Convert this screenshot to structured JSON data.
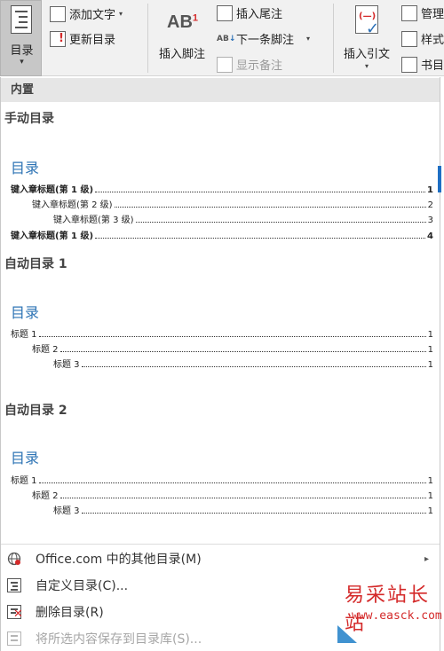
{
  "ribbon": {
    "toc_button": {
      "label": "目录",
      "arrow": "▾"
    },
    "add_text": {
      "label": "添加文字",
      "arrow": "▾"
    },
    "update_toc": {
      "label": "更新目录"
    },
    "insert_footnote": {
      "icon_text": "AB",
      "icon_sup": "1",
      "label": "插入脚注"
    },
    "insert_endnote": {
      "label": "插入尾注"
    },
    "next_footnote": {
      "label": "下一条脚注",
      "arrow": "▾"
    },
    "show_notes": {
      "label": "显示备注"
    },
    "insert_citation": {
      "label": "插入引文",
      "arrow": "▾",
      "icon_text": "(—)"
    },
    "manage": {
      "label": "管理"
    },
    "style": {
      "label": "样式"
    },
    "bibliography": {
      "label": "书目"
    }
  },
  "panel": {
    "section_header": "内置",
    "galleries": [
      {
        "title": "手动目录",
        "heading": "目录",
        "lines": [
          {
            "text": "键入章标题(第 1 级)",
            "page": "1",
            "level": 1,
            "bold": true
          },
          {
            "text": "键入章标题(第 2 级)",
            "page": "2",
            "level": 2,
            "bold": false
          },
          {
            "text": "键入章标题(第 3 级)",
            "page": "3",
            "level": 3,
            "bold": false
          },
          {
            "text": "键入章标题(第 1 级)",
            "page": "4",
            "level": 1,
            "bold": true
          }
        ]
      },
      {
        "title": "自动目录 1",
        "heading": "目录",
        "lines": [
          {
            "text": "标题 1",
            "page": "1",
            "level": 1
          },
          {
            "text": "标题 2",
            "page": "1",
            "level": 2
          },
          {
            "text": "标题 3",
            "page": "1",
            "level": 3
          }
        ]
      },
      {
        "title": "自动目录 2",
        "heading": "目录",
        "lines": [
          {
            "text": "标题 1",
            "page": "1",
            "level": 1
          },
          {
            "text": "标题 2",
            "page": "1",
            "level": 2
          },
          {
            "text": "标题 3",
            "page": "1",
            "level": 3
          }
        ]
      }
    ],
    "menu": [
      {
        "label": "Office.com 中的其他目录(M)",
        "has_submenu": true,
        "submenu_arrow": "▸",
        "enabled": true,
        "icon": "office-globe-icon"
      },
      {
        "label": "自定义目录(C)...",
        "has_submenu": false,
        "enabled": true,
        "icon": "document-icon"
      },
      {
        "label": "删除目录(R)",
        "has_submenu": false,
        "enabled": true,
        "icon": "delete-document-icon"
      },
      {
        "label": "将所选内容保存到目录库(S)...",
        "has_submenu": false,
        "enabled": false,
        "icon": "save-to-gallery-icon"
      }
    ]
  },
  "watermark": {
    "title": "易采站长站",
    "url": "www.easck.com"
  },
  "colors": {
    "accent": "#2e74b5",
    "selected_bg": "#c7c7c7",
    "watermark": "#d42a2a"
  }
}
